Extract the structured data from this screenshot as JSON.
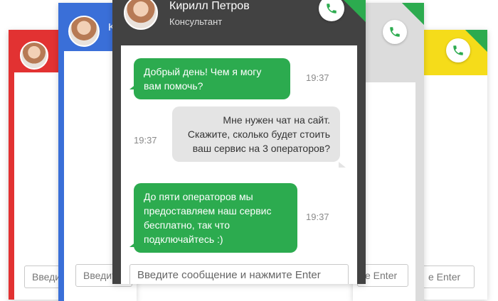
{
  "colors": {
    "red": "#e23232",
    "blue": "#3a6fd8",
    "dark": "#424242",
    "gray": "#dcdcdc",
    "yellow": "#f5dc1a",
    "green": "#2cab4f"
  },
  "agent": {
    "name": "Кирилл Петров",
    "role": "Консультант"
  },
  "messages": [
    {
      "from": "agent",
      "text": "Добрый день! Чем я могу вам помочь?",
      "time": "19:37"
    },
    {
      "from": "user",
      "text": "Мне нужен чат на сайт. Скажите, сколько будет стоить ваш сервис на 3 операторов?",
      "time": "19:37"
    },
    {
      "from": "agent",
      "text": "До пяти операторов мы предоставляем наш сервис бесплатно, так что подключайтесь :)",
      "time": "19:37"
    }
  ],
  "input": {
    "placeholder_main": "Введите сообщение и нажмите Enter",
    "placeholder_red": "Введи",
    "placeholder_blue": "Введите",
    "placeholder_gray": "е Enter",
    "placeholder_yellow": "е Enter"
  },
  "icons": {
    "phone": "phone-icon",
    "avatar": "avatar-image"
  },
  "partial_text": {
    "blue_header_initial": "K"
  }
}
